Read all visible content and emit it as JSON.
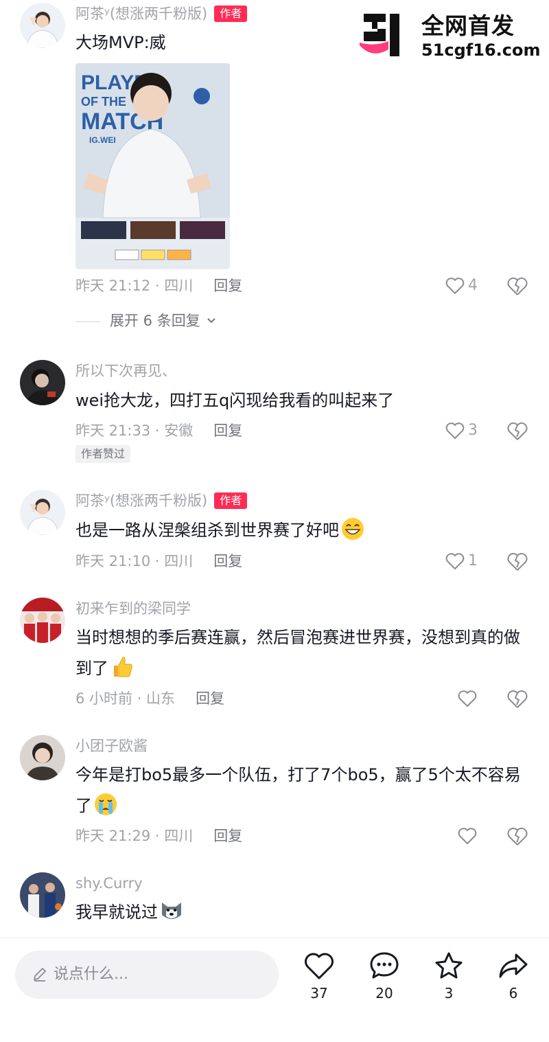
{
  "watermark": {
    "title": "全网首发",
    "url": "51cgf16.com"
  },
  "comments": [
    {
      "username": "阿茶ʸ(想涨两千粉版)",
      "badge": "作者",
      "text": "大场MVP:威",
      "time_location": "昨天 21:12 · 四川",
      "reply_label": "回复",
      "likes": "4",
      "expand_label": "展开 6 条回复"
    },
    {
      "username": "所以下次再见、",
      "text": "wei抢大龙，四打五q闪现给我看的叫起来了",
      "time_location": "昨天 21:33 · 安徽",
      "reply_label": "回复",
      "likes": "3",
      "tag": "作者赞过"
    },
    {
      "username": "阿茶ʸ(想涨两千粉版)",
      "badge": "作者",
      "text": "也是一路从涅槃组杀到世界赛了好吧",
      "emoji": "grin-emoji",
      "time_location": "昨天 21:10 · 四川",
      "reply_label": "回复",
      "likes": "1"
    },
    {
      "username": "初来乍到的梁同学",
      "text": "当时想想的季后赛连赢，然后冒泡赛进世界赛，没想到真的做到了",
      "emoji": "thumbs-up-emoji",
      "time_location": "6 小时前 · 山东",
      "reply_label": "回复",
      "likes": ""
    },
    {
      "username": "小团子欧酱",
      "text": "今年是打bo5最多一个队伍，打了7个bo5，赢了5个太不容易了",
      "emoji": "crying-emoji",
      "time_location": "昨天 21:29 · 四川",
      "reply_label": "回复",
      "likes": ""
    },
    {
      "username": "shy.Curry",
      "text": "我早就说过",
      "emoji": "husky-emoji"
    }
  ],
  "bottom_bar": {
    "placeholder": "说点什么...",
    "likes": "37",
    "comments": "20",
    "favorites": "3",
    "shares": "6"
  },
  "colors": {
    "accent": "#fe2c55",
    "secondary_text": "#a1a3a8",
    "primary_text": "#161823"
  }
}
